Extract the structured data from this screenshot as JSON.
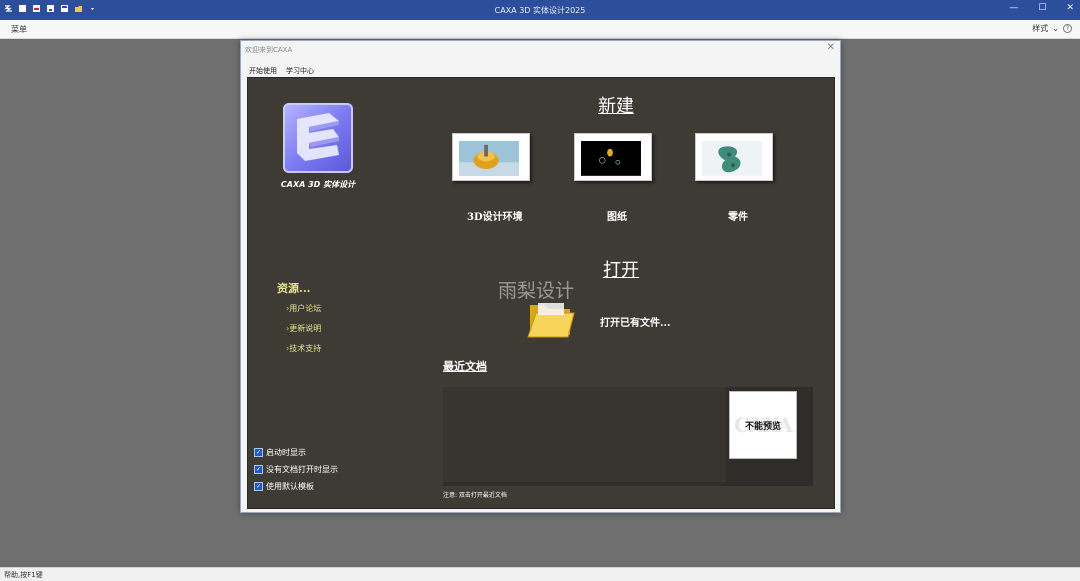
{
  "app": {
    "title": "CAXA 3D 实体设计2025",
    "menu_label": "菜单",
    "style_label": "样式",
    "help_glyph": "?",
    "window_buttons": {
      "minimize": "—",
      "maximize": "☐",
      "close": "✕"
    }
  },
  "status_bar": {
    "text": "帮助,按F1键"
  },
  "dialog": {
    "title": "欢迎来到CAXA",
    "close_glyph": "✕",
    "tabs": [
      {
        "label": "开始使用",
        "active": true
      },
      {
        "label": "学习中心",
        "active": false
      }
    ],
    "logo_text": "CAXA 3D 实体设计",
    "resources": {
      "title": "资源...",
      "links": [
        "›用户论坛",
        "›更新说明",
        "›技术支持"
      ]
    },
    "checkboxes": [
      {
        "label": "启动时显示",
        "checked": true
      },
      {
        "label": "没有文档打开时显示",
        "checked": true
      },
      {
        "label": "使用默认模板",
        "checked": true
      }
    ],
    "new_section": {
      "heading": "新建",
      "items": [
        {
          "label": "3D设计环境",
          "icon": "3d-design-env-thumbnail"
        },
        {
          "label": "图纸",
          "icon": "drawing-thumbnail"
        },
        {
          "label": "零件",
          "icon": "part-thumbnail"
        }
      ]
    },
    "open_section": {
      "heading": "打开",
      "open_existing_label": "打开已有文件...",
      "icon": "folder-icon"
    },
    "watermark": "雨梨设计",
    "recent": {
      "heading": "最近文档",
      "no_preview_label": "不能预览",
      "no_preview_bg": "CAXA",
      "note": "注意: 双击打开最近文档"
    }
  },
  "colors": {
    "title_bar": "#2c4e9b",
    "content_bg": "#3e3b35",
    "resource_yellow": "#e4e28f",
    "checkbox_blue": "#1f5cbd"
  }
}
